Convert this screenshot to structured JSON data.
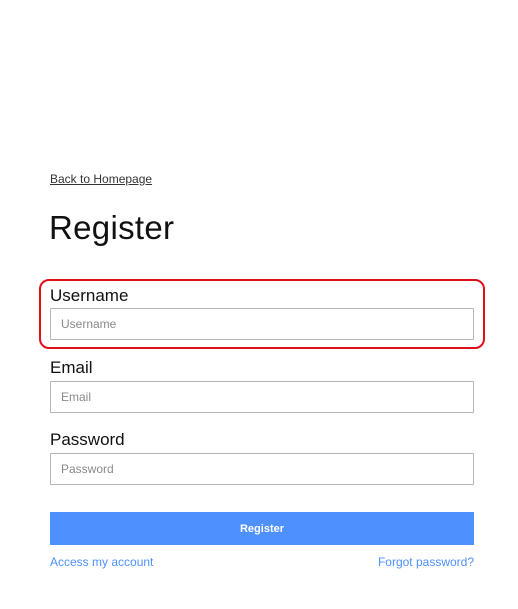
{
  "nav": {
    "back_link": "Back to Homepage"
  },
  "form": {
    "title": "Register",
    "username": {
      "label": "Username",
      "placeholder": "Username",
      "value": ""
    },
    "email": {
      "label": "Email",
      "placeholder": "Email",
      "value": ""
    },
    "password": {
      "label": "Password",
      "placeholder": "Password",
      "value": ""
    },
    "submit_label": "Register"
  },
  "footer": {
    "access_account": "Access my account",
    "forgot_password": "Forgot password?"
  },
  "colors": {
    "accent": "#4d90fe",
    "highlight": "#e0101a"
  }
}
